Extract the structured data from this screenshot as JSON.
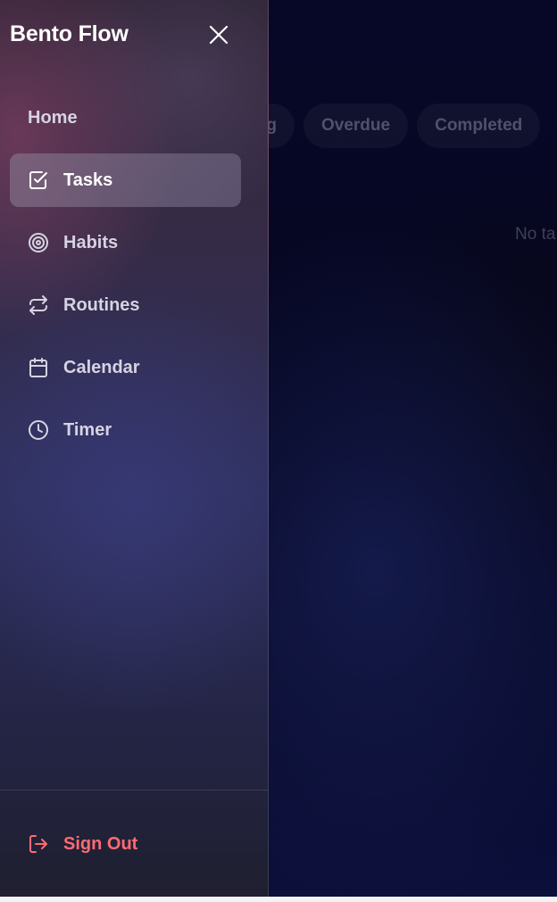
{
  "app": {
    "title": "Bento Flow"
  },
  "drawer": {
    "close_icon": "close-icon",
    "nav": [
      {
        "label": "Home",
        "icon": "",
        "active": false
      },
      {
        "label": "Tasks",
        "icon": "check-square-icon",
        "active": true
      },
      {
        "label": "Habits",
        "icon": "target-icon",
        "active": false
      },
      {
        "label": "Routines",
        "icon": "repeat-icon",
        "active": false
      },
      {
        "label": "Calendar",
        "icon": "calendar-icon",
        "active": false
      },
      {
        "label": "Timer",
        "icon": "clock-icon",
        "active": false
      }
    ],
    "signout": {
      "label": "Sign Out",
      "icon": "sign-out-icon",
      "color": "#ff6b73"
    }
  },
  "main": {
    "filters": [
      "g",
      "Overdue",
      "Completed"
    ],
    "empty_text": "No ta"
  },
  "colors": {
    "accent_danger": "#ff6b73",
    "active_item_bg": "#8c8096",
    "text_primary": "#ffffff",
    "text_nav": "#d6d3e2"
  }
}
